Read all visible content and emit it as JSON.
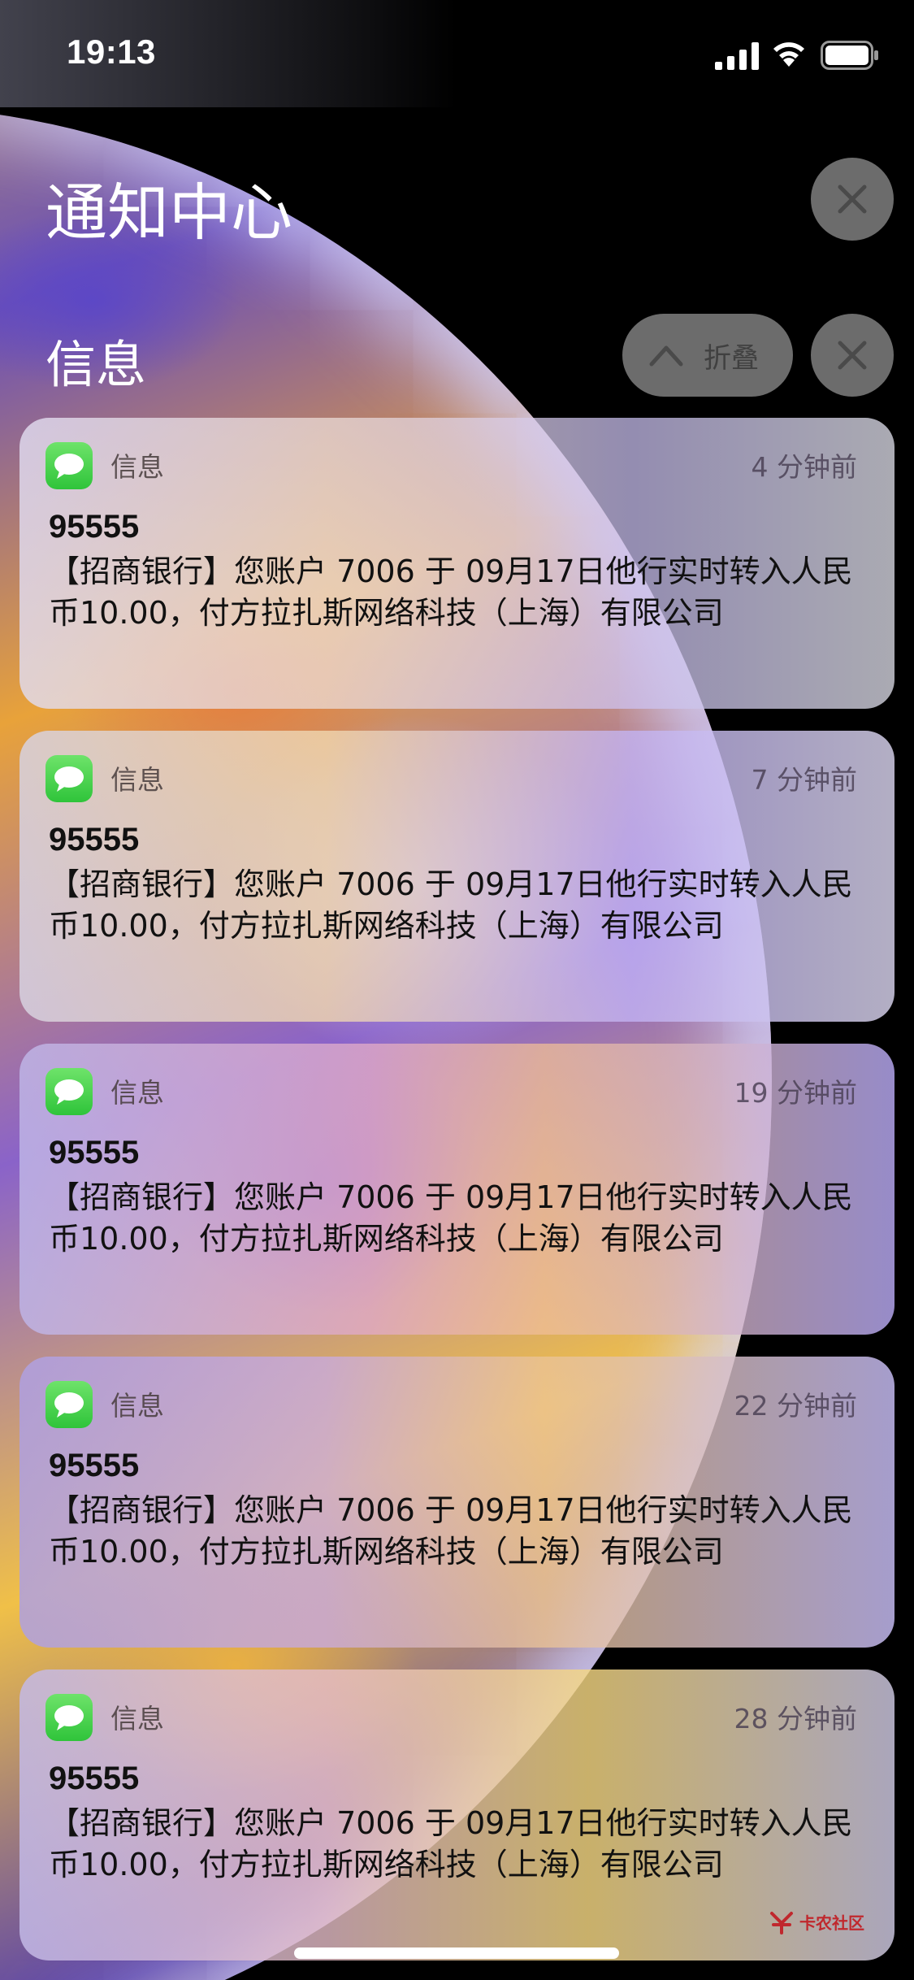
{
  "status_bar": {
    "time": "19:13",
    "icons": [
      "signal-icon",
      "wifi-icon",
      "battery-icon"
    ]
  },
  "header": {
    "title": "通知中心",
    "clear_all_icon": "close-icon"
  },
  "group": {
    "title": "信息",
    "collapse_label": "折叠",
    "collapse_icon": "chevron-up-icon",
    "clear_icon": "close-icon"
  },
  "notifications": [
    {
      "app": "信息",
      "time": "4 分钟前",
      "sender": "95555",
      "body": "【招商银行】您账户 7006 于 09月17日他行实时转入人民币10.00，付方拉扎斯网络科技（上海）有限公司"
    },
    {
      "app": "信息",
      "time": "7 分钟前",
      "sender": "95555",
      "body": "【招商银行】您账户 7006 于 09月17日他行实时转入人民币10.00，付方拉扎斯网络科技（上海）有限公司"
    },
    {
      "app": "信息",
      "time": "19 分钟前",
      "sender": "95555",
      "body": "【招商银行】您账户 7006 于 09月17日他行实时转入人民币10.00，付方拉扎斯网络科技（上海）有限公司"
    },
    {
      "app": "信息",
      "time": "22 分钟前",
      "sender": "95555",
      "body": "【招商银行】您账户 7006 于 09月17日他行实时转入人民币10.00，付方拉扎斯网络科技（上海）有限公司"
    },
    {
      "app": "信息",
      "time": "28 分钟前",
      "sender": "95555",
      "body": "【招商银行】您账户 7006 于 09月17日他行实时转入人民币10.00，付方拉扎斯网络科技（上海）有限公司"
    }
  ],
  "watermark": {
    "text": "卡农社区"
  },
  "colors": {
    "messages_green": "#34c759",
    "button_gray": "#969696"
  }
}
